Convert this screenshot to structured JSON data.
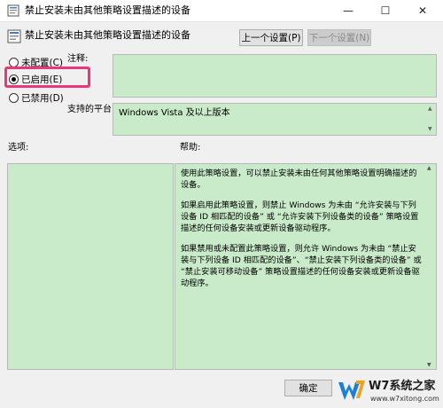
{
  "window": {
    "title": "禁止安装未由其他策略设置描述的设备",
    "controls": {
      "minimize": "—",
      "maximize": "☐",
      "close": "✕"
    }
  },
  "header": {
    "title": "禁止安装未由其他策略设置描述的设备"
  },
  "nav": {
    "prev_label": "上一个设置(P)",
    "next_label": "下一个设置(N)"
  },
  "state": {
    "options": [
      {
        "label": "未配置(C)",
        "checked": false
      },
      {
        "label": "已启用(E)",
        "checked": true
      },
      {
        "label": "已禁用(D)",
        "checked": false
      }
    ]
  },
  "labels": {
    "comment": "注释:",
    "supported_on": "支持的平台:",
    "options": "选项:",
    "help": "帮助:"
  },
  "supported_on_value": "Windows Vista 及以上版本",
  "help_paragraphs": [
    "使用此策略设置，可以禁止安装未由任何其他策略设置明确描述的设备。",
    "如果启用此策略设置，则禁止 Windows 为未由 “允许安装与下列设备 ID 相匹配的设备” 或 “允许安装下列设备类的设备” 策略设置描述的任何设备安装或更新设备驱动程序。",
    "如果禁用或未配置此策略设置，则允许 Windows 为未由 “禁止安装与下列设备 ID 相匹配的设备”、“禁止安装下列设备类的设备” 或 “禁止安装可移动设备” 策略设置描述的任何设备安装或更新设备驱动程序。"
  ],
  "footer": {
    "ok_label": "确定"
  },
  "watermark": {
    "text": "W7系统之家",
    "url": "www.w7xitong.com"
  },
  "colors": {
    "pane_green": "#c9ebc9",
    "highlight": "#e8387a"
  }
}
